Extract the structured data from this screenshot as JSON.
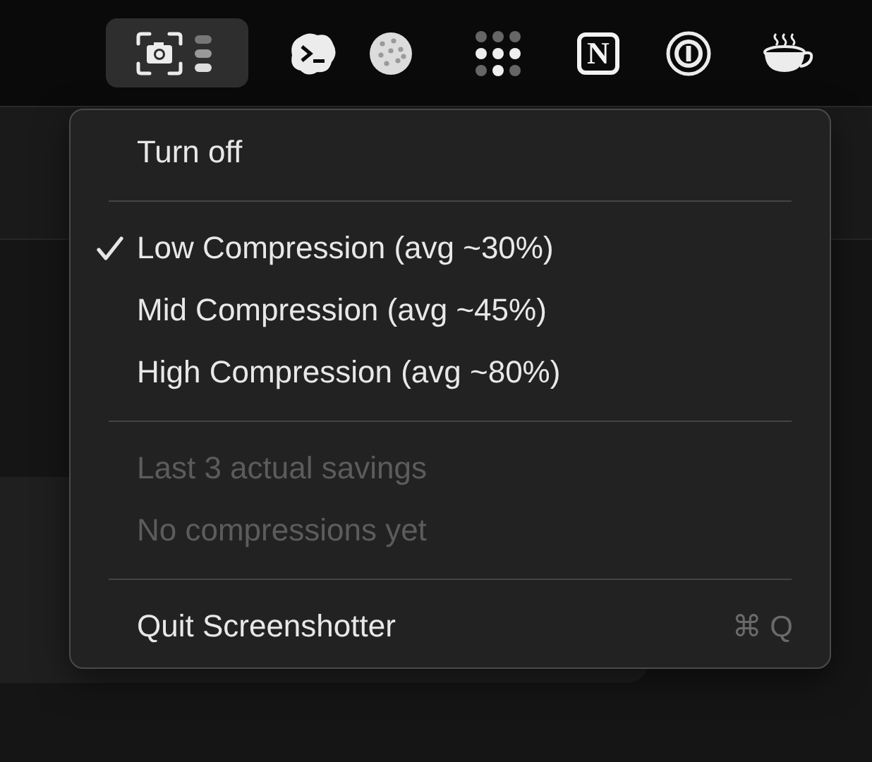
{
  "menu_bar": {
    "items": [
      {
        "kind": "screenshot",
        "selected": true
      },
      {
        "kind": "terminal",
        "selected": false
      },
      {
        "kind": "cookie",
        "selected": false
      },
      {
        "kind": "dots",
        "selected": false
      },
      {
        "kind": "letter",
        "glyph": "N",
        "selected": false
      },
      {
        "kind": "ring",
        "selected": false
      },
      {
        "kind": "cup",
        "selected": false
      }
    ]
  },
  "menu": {
    "items": [
      {
        "kind": "item",
        "label": "Turn off",
        "checked": false,
        "disabled": false
      },
      {
        "kind": "separator"
      },
      {
        "kind": "item",
        "label": "Low Compression (avg ~30%)",
        "checked": true,
        "disabled": false
      },
      {
        "kind": "item",
        "label": "Mid Compression (avg ~45%)",
        "checked": false,
        "disabled": false
      },
      {
        "kind": "item",
        "label": "High Compression (avg ~80%)",
        "checked": false,
        "disabled": false
      },
      {
        "kind": "separator"
      },
      {
        "kind": "item",
        "label": "Last 3 actual savings",
        "checked": false,
        "disabled": true
      },
      {
        "kind": "item",
        "label": "No compressions yet",
        "checked": false,
        "disabled": true
      },
      {
        "kind": "separator"
      },
      {
        "kind": "item",
        "label": "Quit Screenshotter",
        "checked": false,
        "disabled": false,
        "shortcut": "⌘ Q"
      }
    ]
  }
}
